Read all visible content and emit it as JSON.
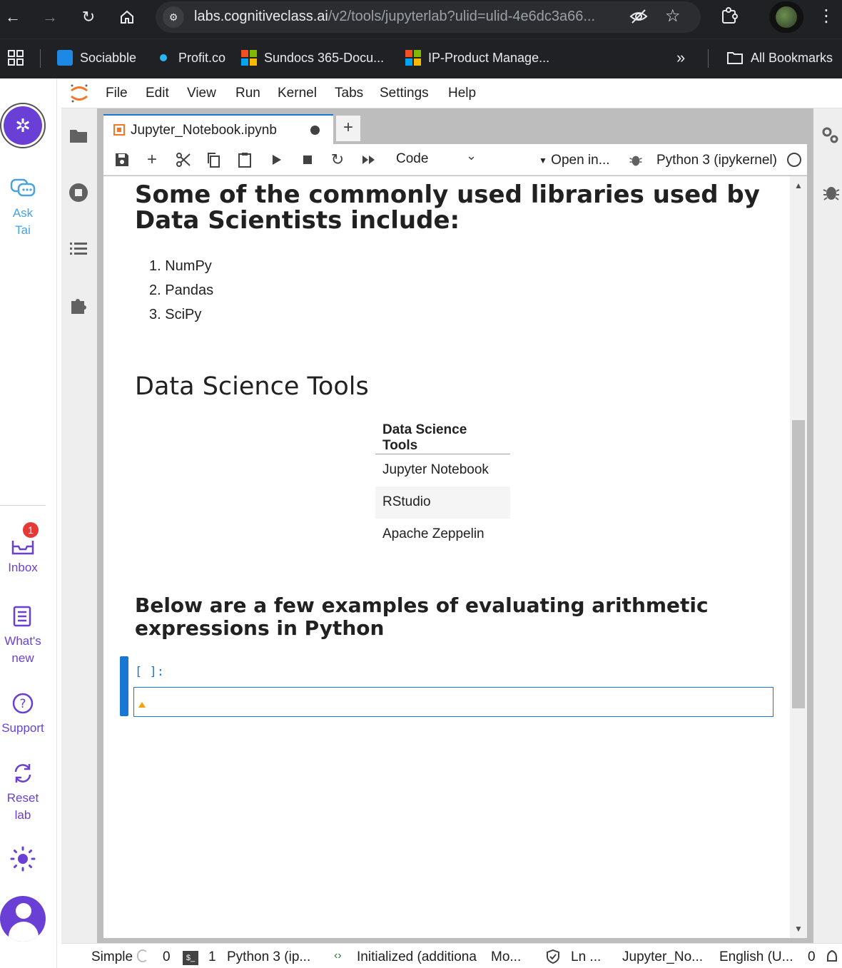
{
  "browser": {
    "url_host": "labs.cognitiveclass.ai",
    "url_path": "/v2/tools/jupyterlab?ulid=ulid-4e6dc3a66...",
    "bookmarks": [
      {
        "label": "Sociabble",
        "icon": "sociabble-icon"
      },
      {
        "label": "Profit.co",
        "icon": "profit-icon"
      },
      {
        "label": "Sundocs 365-Docu...",
        "icon": "microsoft-icon"
      },
      {
        "label": "IP-Product Manage...",
        "icon": "microsoft-icon"
      }
    ],
    "more": "»",
    "all_bookmarks": "All Bookmarks"
  },
  "rail": {
    "ask": "Ask\nTai",
    "inbox": "Inbox",
    "inbox_badge": "1",
    "whats_new": "What's\nnew",
    "support": "Support",
    "reset": "Reset\nlab"
  },
  "menu": [
    "File",
    "Edit",
    "View",
    "Run",
    "Kernel",
    "Tabs",
    "Settings",
    "Help"
  ],
  "tab": {
    "title": "Jupyter_Notebook.ipynb",
    "add": "+"
  },
  "toolbar": {
    "cell_type": "Code",
    "open_in": "Open in...",
    "kernel": "Python 3 (ipykernel)"
  },
  "notebook": {
    "libs_heading": "Some of the commonly used libraries used by Data Scientists include:",
    "libs": [
      "1. NumPy",
      "2. Pandas",
      "3. SciPy"
    ],
    "tools_heading": "Data Science Tools",
    "table_header": "Data Science Tools",
    "table_rows": [
      "Jupyter Notebook",
      "RStudio",
      "Apache Zeppelin"
    ],
    "arith_heading": "Below are a few examples of evaluating arithmetic expressions in Python",
    "prompt": "[ ]:"
  },
  "status": {
    "mode": "Simple",
    "count0": "0",
    "count1": "1",
    "kernel": "Python 3 (ip...",
    "lsp": "Initialized (additiona",
    "mo": "Mo...",
    "ln": "Ln ...",
    "file": "Jupyter_No...",
    "lang": "English (U...",
    "last": "0"
  },
  "colors": {
    "accent": "#1976d2",
    "brand": "#6a3fd6",
    "jupyter": "#f37726"
  }
}
